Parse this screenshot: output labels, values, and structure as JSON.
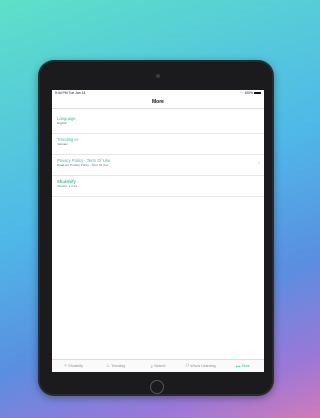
{
  "status_bar": {
    "time_date": "9:44 PM  Tue Jan 14",
    "battery": "100%"
  },
  "nav": {
    "title": "More"
  },
  "rows": [
    {
      "title": "Language",
      "subtitle": "English"
    },
    {
      "title": "Trending in",
      "subtitle": "Vietnam"
    },
    {
      "title": "Privacy Policy - Term Of Use",
      "subtitle": "Read our Privacy Policy - Term Of Use"
    },
    {
      "title": "Shuishify",
      "subtitle": "Version: 1.1.21"
    }
  ],
  "tabs": [
    {
      "label": "Shuishify",
      "icon": "sparkle-icon"
    },
    {
      "label": "Trending",
      "icon": "flame-icon"
    },
    {
      "label": "Search",
      "icon": "search-icon"
    },
    {
      "label": "Who's Listening",
      "icon": "people-icon"
    },
    {
      "label": "More",
      "icon": "ellipsis-icon"
    }
  ],
  "colors": {
    "accent": "#3bbf8f"
  }
}
